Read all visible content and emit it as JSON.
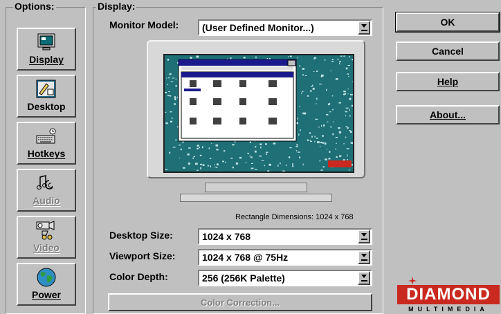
{
  "options": {
    "title": "Options:",
    "items": [
      {
        "label": "Display",
        "icon": "monitor-icon",
        "enabled": true
      },
      {
        "label": "Desktop",
        "icon": "desktop-icon",
        "enabled": true
      },
      {
        "label": "Hotkeys",
        "icon": "keyboard-icon",
        "enabled": true
      },
      {
        "label": "Audio",
        "icon": "audio-icon",
        "enabled": false
      },
      {
        "label": "Video",
        "icon": "video-camera-icon",
        "enabled": false
      },
      {
        "label": "Power",
        "icon": "globe-icon",
        "enabled": true
      }
    ]
  },
  "display": {
    "title": "Display:",
    "monitor_model_label": "Monitor Model:",
    "monitor_model_value": "(User Defined Monitor...)",
    "rectangle_dimensions": "Rectangle Dimensions:  1024 x 768",
    "desktop_size_label": "Desktop Size:",
    "desktop_size_value": "1024 x 768",
    "viewport_size_label": "Viewport Size:",
    "viewport_size_value": "1024 x 768 @ 75Hz",
    "color_depth_label": "Color Depth:",
    "color_depth_value": "256 (256K Palette)",
    "color_correction_label": "Color Correction..."
  },
  "buttons": {
    "ok": "OK",
    "cancel": "Cancel",
    "help": "Help",
    "about": "About..."
  },
  "logo": {
    "name": "DIAMOND",
    "sub": "MULTIMEDIA",
    "color": "#c9291e"
  }
}
